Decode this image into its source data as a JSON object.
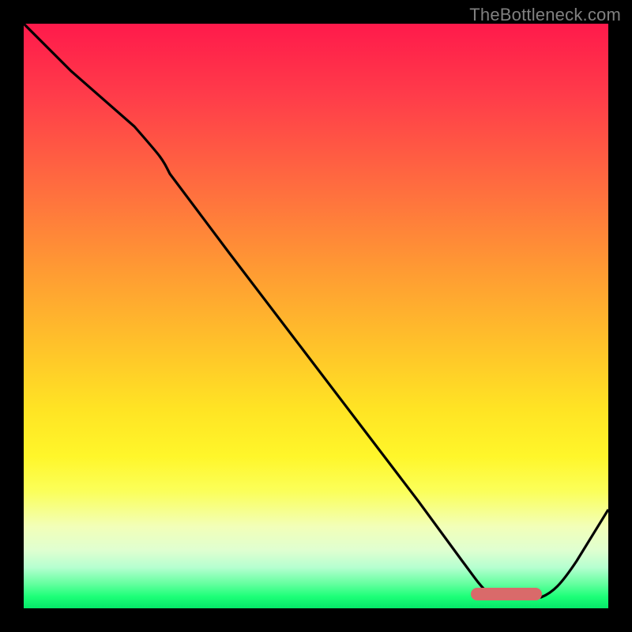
{
  "attribution": "TheBottleneck.com",
  "colors": {
    "marker": "#d96a6a",
    "curve": "#000000"
  },
  "chart_data": {
    "type": "line",
    "title": "",
    "xlabel": "",
    "ylabel": "",
    "xlim": [
      0,
      100
    ],
    "ylim": [
      0,
      100
    ],
    "grid": false,
    "legend": false,
    "x": [
      0,
      5,
      12,
      20,
      23,
      30,
      40,
      50,
      60,
      70,
      75,
      78,
      82,
      86,
      90,
      95,
      100
    ],
    "values": [
      100,
      94,
      85,
      76,
      72,
      62,
      48,
      35,
      22,
      9,
      3,
      1,
      0,
      0,
      3,
      10,
      18
    ],
    "optimal_band_x": [
      78,
      88
    ],
    "optimal_band_y": 2,
    "gradient_stops": [
      {
        "pos": 0,
        "color": "#ff1a4b"
      },
      {
        "pos": 28,
        "color": "#ff6d3f"
      },
      {
        "pos": 55,
        "color": "#ffc22a"
      },
      {
        "pos": 74,
        "color": "#fff62a"
      },
      {
        "pos": 90,
        "color": "#e0ffd0"
      },
      {
        "pos": 100,
        "color": "#05e868"
      }
    ]
  }
}
